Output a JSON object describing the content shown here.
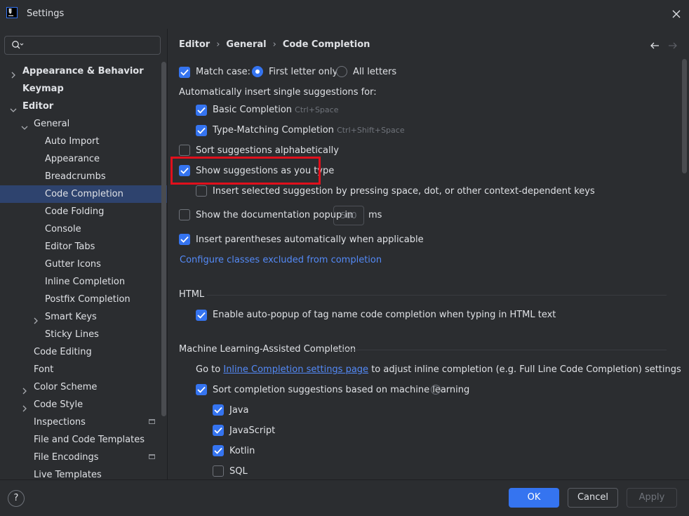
{
  "window": {
    "title": "Settings"
  },
  "search": {
    "placeholder": ""
  },
  "sidebar": {
    "items": [
      {
        "label": "Appearance & Behavior",
        "bold": true,
        "chevron": "right"
      },
      {
        "label": "Keymap",
        "bold": true
      },
      {
        "label": "Editor",
        "bold": true,
        "chevron": "down"
      },
      {
        "label": "General",
        "chevron": "down"
      },
      {
        "label": "Auto Import"
      },
      {
        "label": "Appearance"
      },
      {
        "label": "Breadcrumbs"
      },
      {
        "label": "Code Completion",
        "selected": true
      },
      {
        "label": "Code Folding"
      },
      {
        "label": "Console"
      },
      {
        "label": "Editor Tabs"
      },
      {
        "label": "Gutter Icons"
      },
      {
        "label": "Inline Completion"
      },
      {
        "label": "Postfix Completion"
      },
      {
        "label": "Smart Keys",
        "chevron": "right"
      },
      {
        "label": "Sticky Lines"
      },
      {
        "label": "Code Editing"
      },
      {
        "label": "Font"
      },
      {
        "label": "Color Scheme",
        "chevron": "right"
      },
      {
        "label": "Code Style",
        "chevron": "right"
      },
      {
        "label": "Inspections",
        "icon": "page-icon"
      },
      {
        "label": "File and Code Templates"
      },
      {
        "label": "File Encodings",
        "icon": "page-icon"
      },
      {
        "label": "Live Templates"
      }
    ]
  },
  "breadcrumb": [
    "Editor",
    "General",
    "Code Completion"
  ],
  "content": {
    "match_case": {
      "label": "Match case:",
      "checked": true
    },
    "radio_first_letter": {
      "label": "First letter only",
      "selected": true
    },
    "radio_all_letters": {
      "label": "All letters",
      "selected": false
    },
    "auto_insert_heading": "Automatically insert single suggestions for:",
    "basic_completion": {
      "label": "Basic Completion",
      "shortcut": "Ctrl+Space",
      "checked": true
    },
    "type_matching": {
      "label": "Type-Matching Completion",
      "shortcut": "Ctrl+Shift+Space",
      "checked": true
    },
    "sort_alpha": {
      "label": "Sort suggestions alphabetically",
      "checked": false
    },
    "show_as_you_type": {
      "label": "Show suggestions as you type",
      "checked": true
    },
    "insert_selected": {
      "label": "Insert selected suggestion by pressing space, dot, or other context-dependent keys",
      "checked": false
    },
    "doc_popup": {
      "label": "Show the documentation popup in",
      "value": "500",
      "unit": "ms",
      "checked": false
    },
    "insert_parens": {
      "label": "Insert parentheses automatically when applicable",
      "checked": true
    },
    "configure_link": "Configure classes excluded from completion",
    "html_section": "HTML",
    "html_autopopup": {
      "label": "Enable auto-popup of tag name code completion when typing in HTML text",
      "checked": true
    },
    "ml_section": "Machine Learning-Assisted Completion",
    "ml_goto_prefix": "Go to",
    "ml_goto_link": "Inline Completion settings page",
    "ml_goto_suffix": "to adjust inline completion (e.g. Full Line Code Completion) settings",
    "ml_sort": {
      "label": "Sort completion suggestions based on machine learning",
      "checked": true
    },
    "ml_langs": [
      {
        "label": "Java",
        "checked": true
      },
      {
        "label": "JavaScript",
        "checked": true
      },
      {
        "label": "Kotlin",
        "checked": true
      },
      {
        "label": "SQL",
        "checked": false
      }
    ]
  },
  "buttons": {
    "help": "?",
    "ok": "OK",
    "cancel": "Cancel",
    "apply": "Apply"
  },
  "colors": {
    "accent": "#3574f0",
    "highlight_box": "#e0101c",
    "link": "#548af7",
    "selection": "#2e436e"
  }
}
